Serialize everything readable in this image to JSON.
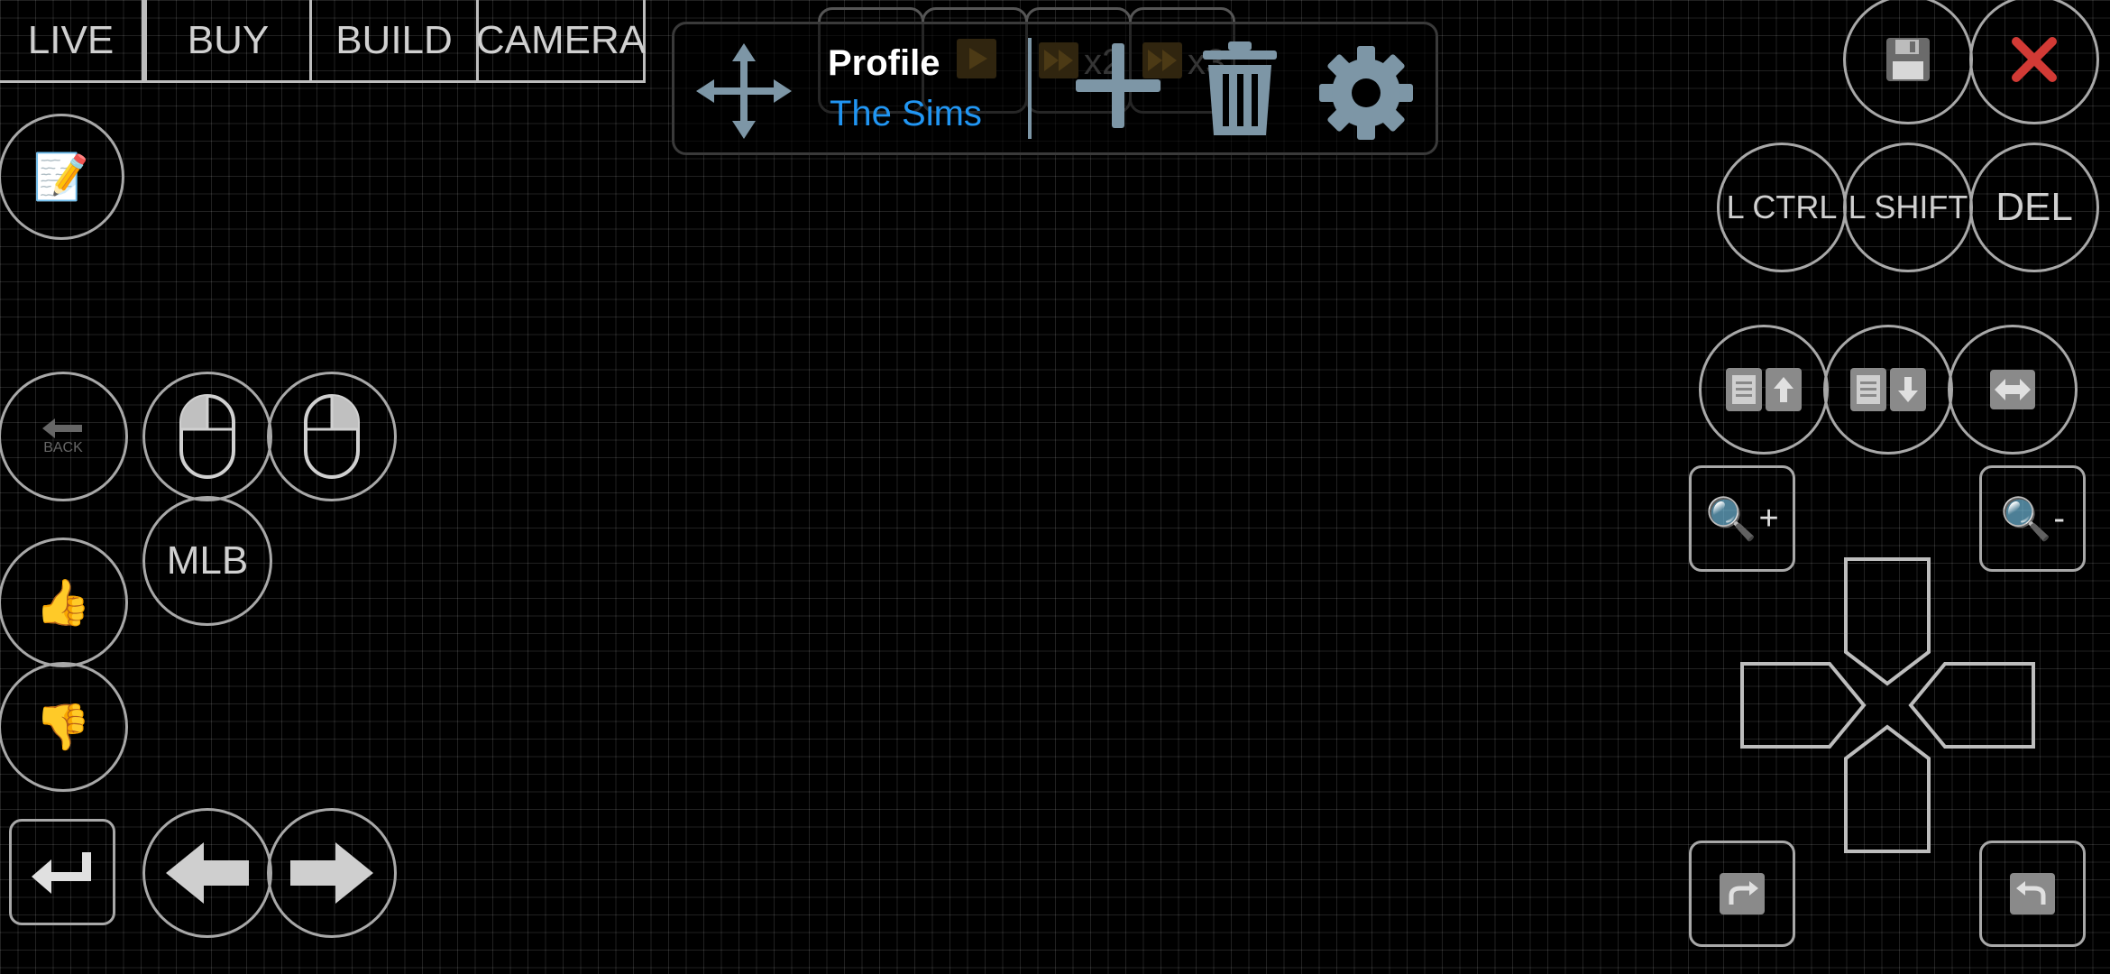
{
  "tabs": [
    {
      "label": "LIVE"
    },
    {
      "label": "BUY"
    },
    {
      "label": "BUILD"
    },
    {
      "label": "CAMERA"
    }
  ],
  "profile": {
    "title": "Profile",
    "name": "The Sims"
  },
  "speed_controls": {
    "x2_label": "x2",
    "x3_label": "x3"
  },
  "buttons": {
    "mlb": "MLB",
    "lctrl": "L CTRL",
    "lshift": "L SHIFT",
    "del": "DEL",
    "back_small": "BACK",
    "zoom_in_sign": "+",
    "zoom_out_sign": "-"
  },
  "icons": {
    "move": "move-arrows-icon",
    "add": "plus-icon",
    "delete": "trash-icon",
    "settings": "gear-icon",
    "save": "floppy-disk-icon",
    "close": "close-x-icon"
  },
  "colors": {
    "accent": "#2196f3",
    "icon_gray": "#7d96a6",
    "close_red": "#d23a35",
    "outline": "#a8a8a8"
  }
}
